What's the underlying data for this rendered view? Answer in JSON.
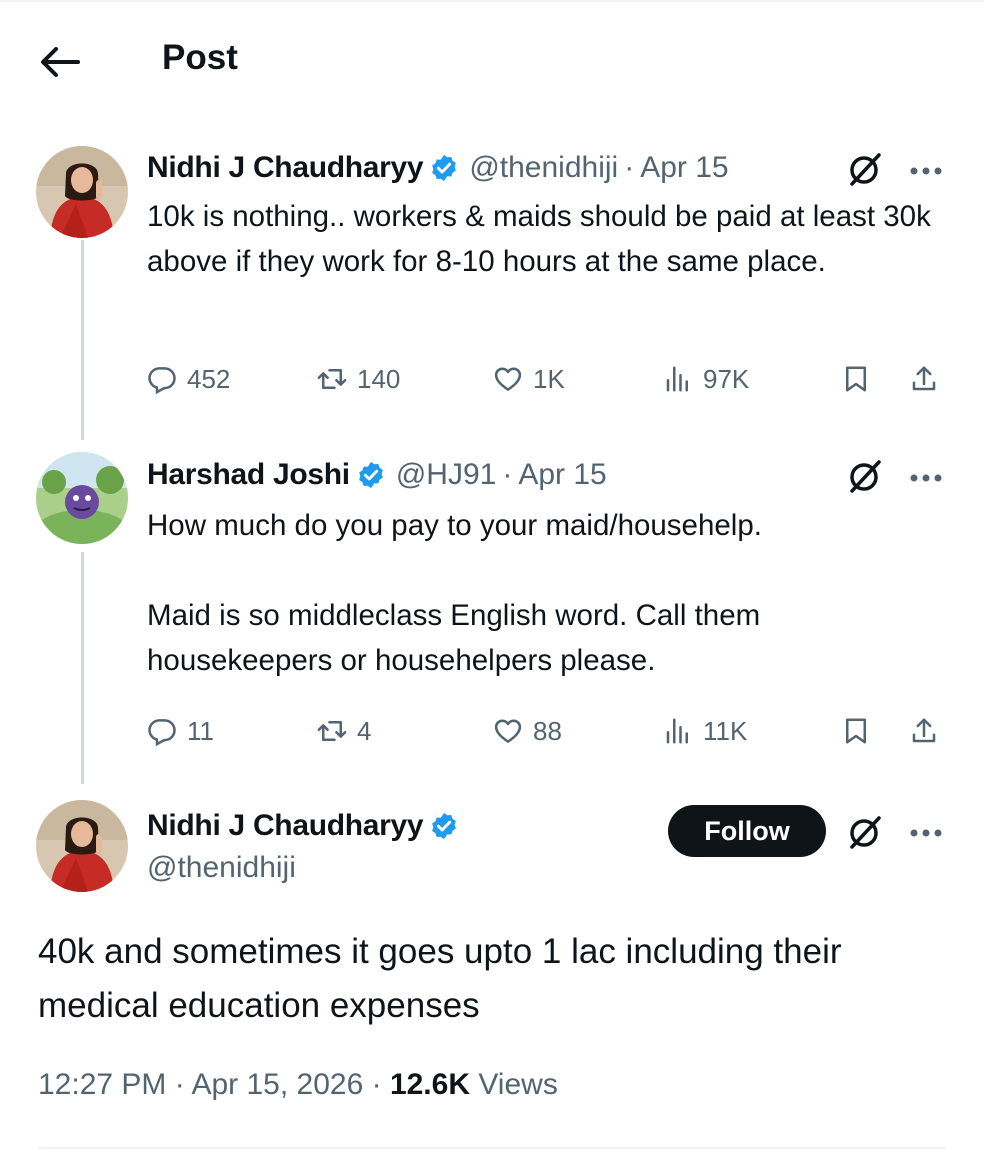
{
  "header": {
    "title": "Post"
  },
  "tweets": [
    {
      "name": "Nidhi J Chaudharyy",
      "handle": "@thenidhiji",
      "separator": "·",
      "date": "Apr 15",
      "text": "10k is nothing.. workers & maids should be paid at least 30k above if they work for 8-10 hours at the same place.",
      "replies": "452",
      "reposts": "140",
      "likes": "1K",
      "views": "97K"
    },
    {
      "name": "Harshad Joshi",
      "handle": "@HJ91",
      "separator": "·",
      "date": "Apr 15",
      "text": "How much do you pay to your maid/househelp.\n\nMaid is so middleclass English word. Call them housekeepers or househelpers please.",
      "replies": "11",
      "reposts": "4",
      "likes": "88",
      "views": "11K"
    }
  ],
  "main": {
    "name": "Nidhi J Chaudharyy",
    "handle": "@thenidhiji",
    "follow_label": "Follow",
    "text": "40k and sometimes it goes upto 1 lac including their medical education expenses",
    "time": "12:27 PM",
    "sep": "·",
    "date": "Apr 15, 2026",
    "views_count": "12.6K",
    "views_label": "Views"
  },
  "colors": {
    "verified": "#1d9bf0",
    "text": "#0f1419",
    "secondary": "#536471",
    "thread_line": "#cfd9de"
  }
}
